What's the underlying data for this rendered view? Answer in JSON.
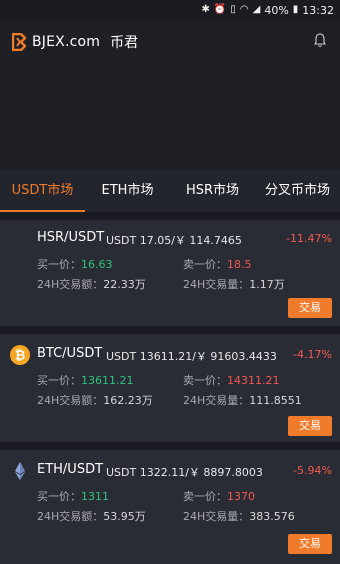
{
  "status_bar": {
    "battery": "40%",
    "time": "13:32"
  },
  "header": {
    "app_name": "BJEX.com",
    "app_name_cn": "币君"
  },
  "tabs": [
    {
      "label": "USDT市场",
      "active": true
    },
    {
      "label": "ETH市场"
    },
    {
      "label": "HSR市场"
    },
    {
      "label": "分叉币市场"
    }
  ],
  "markets": [
    {
      "pair": "HSR/USDT",
      "price": "USDT 17.05/￥ 114.7465",
      "change": "-11.47%",
      "buy_label": "买一价：",
      "buy": "16.63",
      "sell_label": "卖一价：",
      "sell": "18.5",
      "volume_amount_label": "24H交易额：",
      "volume_amount": "22.33万",
      "volume_qty_label": "24H交易量：",
      "volume_qty": "1.17万",
      "trade_label": "交易"
    },
    {
      "pair": "BTC/USDT",
      "price": "USDT 13611.21/￥ 91603.4433",
      "change": "-4.17%",
      "buy_label": "买一价：",
      "buy": "13611.21",
      "sell_label": "卖一价：",
      "sell": "14311.21",
      "volume_amount_label": "24H交易额：",
      "volume_amount": "162.23万",
      "volume_qty_label": "24H交易量：",
      "volume_qty": "111.8551",
      "trade_label": "交易"
    },
    {
      "pair": "ETH/USDT",
      "price": "USDT 1322.11/￥ 8897.8003",
      "change": "-5.94%",
      "buy_label": "买一价：",
      "buy": "1311",
      "sell_label": "卖一价：",
      "sell": "1370",
      "volume_amount_label": "24H交易额：",
      "volume_amount": "53.95万",
      "volume_qty_label": "24H交易量：",
      "volume_qty": "383.576",
      "trade_label": "交易"
    }
  ],
  "colors": {
    "accent": "#f07b2a",
    "up": "#2ec27e",
    "down": "#f2584e",
    "bg": "#1a1b21",
    "card": "#2a2c35"
  }
}
